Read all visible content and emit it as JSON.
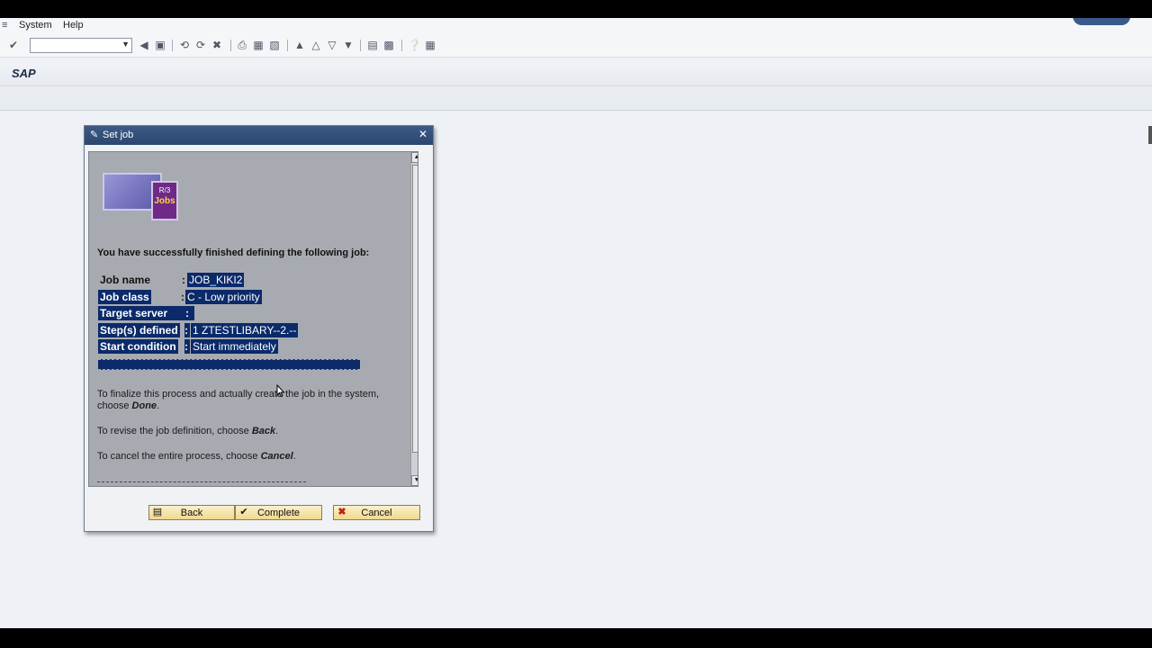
{
  "menubar": {
    "items": [
      "System",
      "Help"
    ]
  },
  "header": {
    "title": "SAP"
  },
  "dialog": {
    "title": "Set job",
    "logo": {
      "line1": "R/3",
      "line2": "Jobs"
    },
    "success_message": "You have successfully finished defining the following job:",
    "job_rows": [
      {
        "label": "Job name",
        "value": "JOB_KIKI2"
      },
      {
        "label": "Job class",
        "value": "C - Low priority"
      },
      {
        "label": "Target server",
        "value": ""
      },
      {
        "label": "Step(s) defined",
        "value": "1 ZTESTLIBARY--2.--"
      },
      {
        "label": "Start condition",
        "value": "Start immediately"
      }
    ],
    "finalize_line1": "To finalize this process and actually create the job in the system,",
    "finalize_line2_prefix": "choose ",
    "finalize_keyword": "Done",
    "revise_prefix": "To revise the job definition, choose ",
    "revise_keyword": "Back",
    "cancel_prefix": "To cancel the entire process, choose ",
    "cancel_keyword": "Cancel",
    "buttons": {
      "back": "Back",
      "complete": "Complete",
      "cancel": "Cancel"
    }
  },
  "colors": {
    "selection": "#0a2a6a",
    "title_bar": "#2b4670",
    "button": "#f0d98f"
  }
}
